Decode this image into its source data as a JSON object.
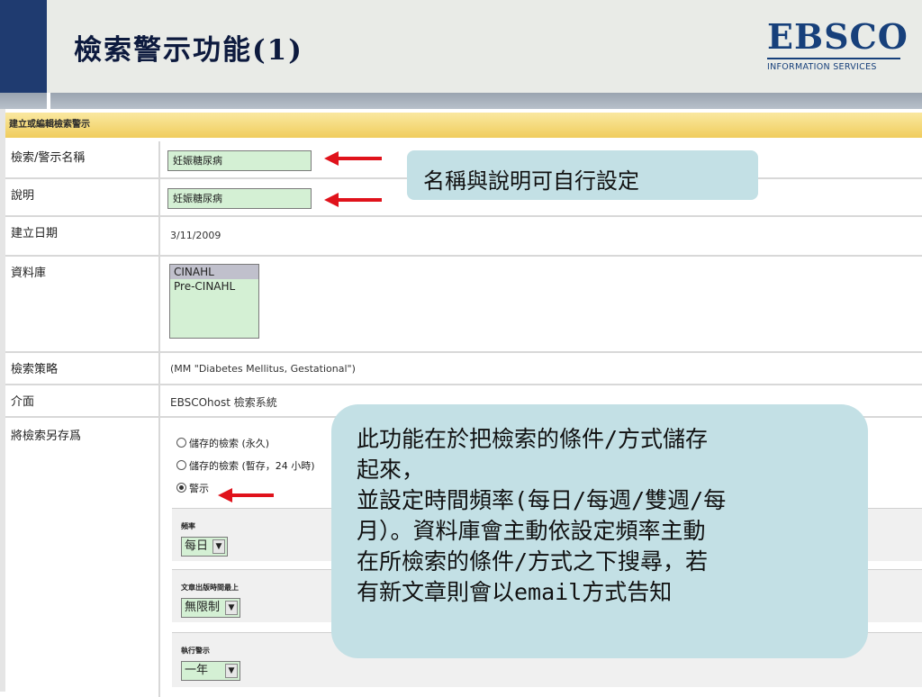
{
  "slide": {
    "title": "檢索警示功能(1)",
    "logo_main": "EBSCO",
    "logo_sub": "INFORMATION SERVICES"
  },
  "form": {
    "heading": "建立或編輯檢索警示",
    "name_label": "檢索/警示名稱",
    "name_value": "妊娠糖尿病",
    "desc_label": "說明",
    "desc_value": "妊娠糖尿病",
    "date_label": "建立日期",
    "date_value": "3/11/2009",
    "db_label": "資料庫",
    "db_options": [
      "CINAHL",
      "Pre-CINAHL"
    ],
    "strategy_label": "檢索策略",
    "strategy_value": "(MM \"Diabetes Mellitus, Gestational\")",
    "interface_label": "介面",
    "interface_value": "EBSCOhost 檢索系統",
    "save_as_label": "將檢索另存爲",
    "save_options": [
      {
        "label": "儲存的檢索 (永久)",
        "selected": false
      },
      {
        "label": "儲存的檢索 (暫存，24 小時)",
        "selected": false
      },
      {
        "label": "警示",
        "selected": true
      }
    ],
    "frequency_label": "頻率",
    "frequency_value": "每日",
    "published_label": "文章出版時間最上",
    "published_value": "無限制",
    "run_label": "執行警示",
    "run_value": "一年"
  },
  "callouts": {
    "small": "名稱與說明可自行設定",
    "big_lines": [
      "此功能在於把檢索的條件/方式儲存",
      "起來，",
      "並設定時間頻率(每日/每週/雙週/每",
      "月）。資料庫會主動依設定頻率主動",
      "在所檢索的條件/方式之下搜尋，若",
      "有新文章則會以email方式告知"
    ]
  },
  "colors": {
    "accent_navy": "#1f3b70",
    "form_heading_yellow": "#f0cd5d",
    "input_green": "#d4f0d4",
    "callout_blue": "#c3e0e5",
    "arrow_red": "#e0121b"
  }
}
